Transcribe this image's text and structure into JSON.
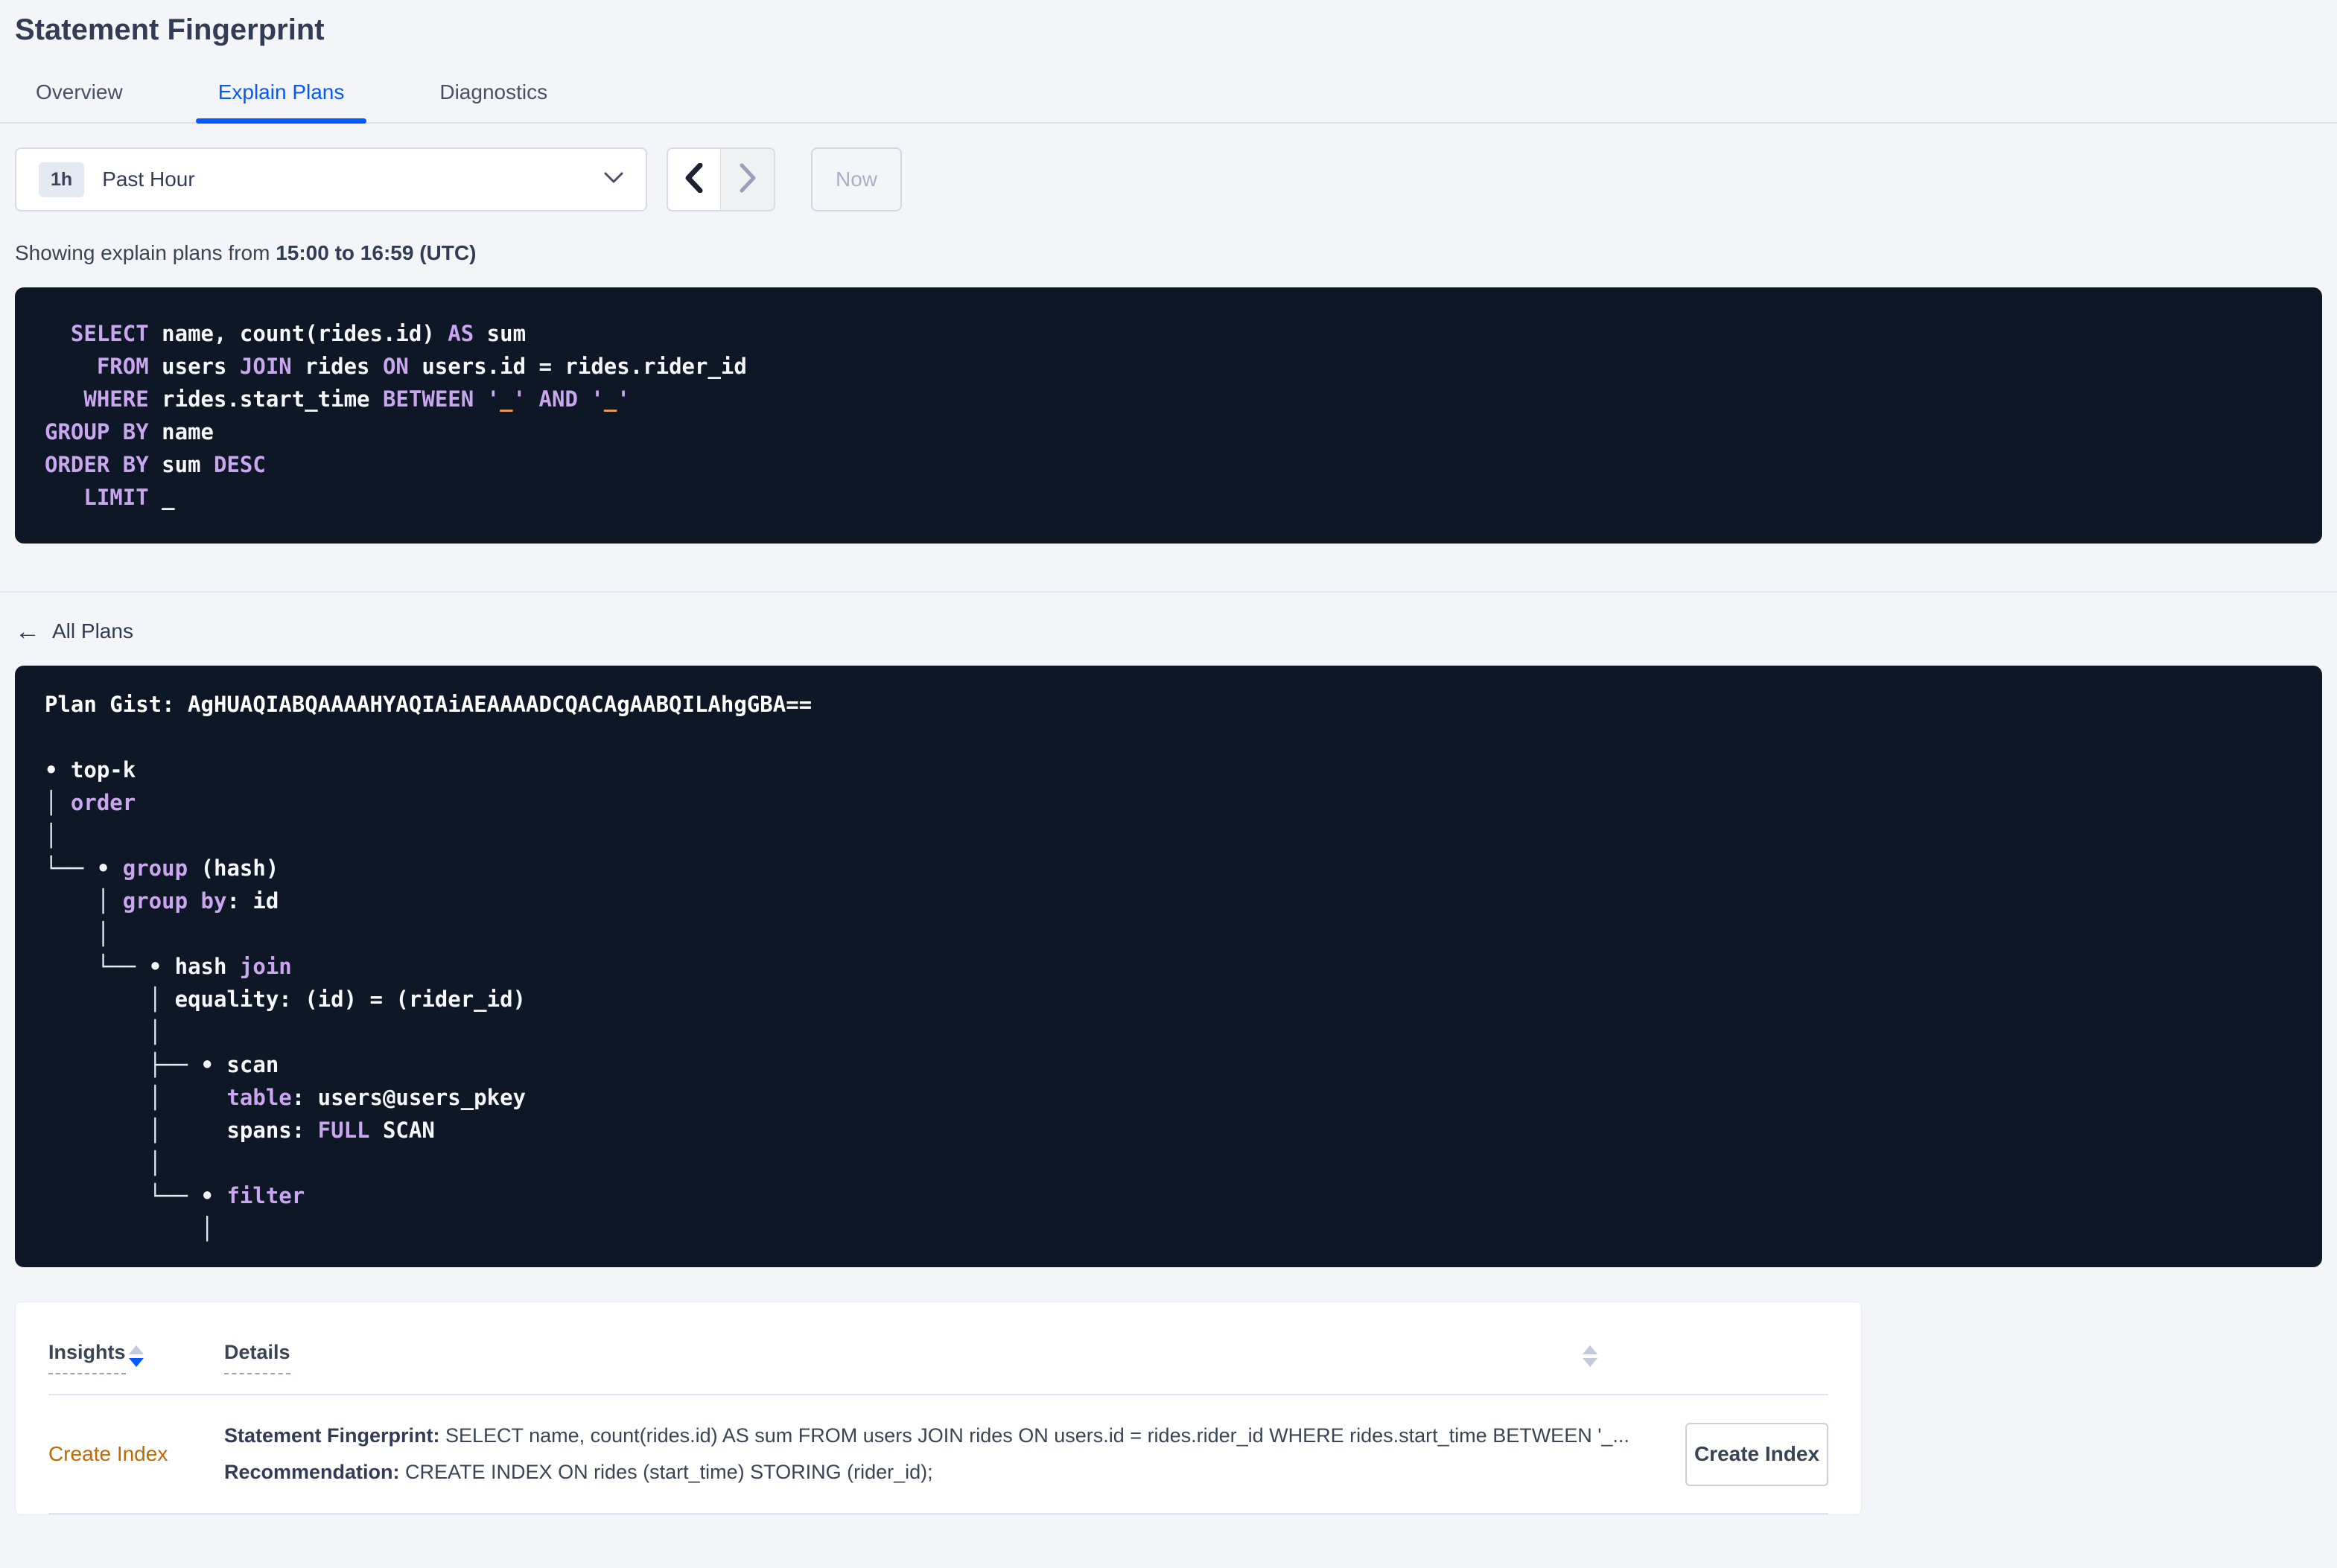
{
  "page": {
    "title": "Statement Fingerprint"
  },
  "tabs": [
    {
      "label": "Overview"
    },
    {
      "label": "Explain Plans"
    },
    {
      "label": "Diagnostics"
    }
  ],
  "toolbar": {
    "time_badge": "1h",
    "time_label": "Past Hour",
    "now_label": "Now"
  },
  "subtitle": {
    "prefix": "Showing explain plans from ",
    "bold": "15:00 to 16:59 (UTC)"
  },
  "colors": {
    "accent_blue": "#0458ff",
    "insight_orange": "#bf6a02",
    "code_background": "#0e1726",
    "code_keyword_purple": "#c9a6ee",
    "code_literal_orange": "#faa14c",
    "page_background": "#f4f5f9"
  },
  "sql_block": {
    "lines": [
      [
        [
          "p",
          "  "
        ],
        [
          "k",
          "SELECT"
        ],
        [
          "p",
          " name, count(rides.id) "
        ],
        [
          "k",
          "AS"
        ],
        [
          "p",
          " sum"
        ]
      ],
      [
        [
          "p",
          "    "
        ],
        [
          "k",
          "FROM"
        ],
        [
          "p",
          " users "
        ],
        [
          "k",
          "JOIN"
        ],
        [
          "p",
          " rides "
        ],
        [
          "k",
          "ON"
        ],
        [
          "p",
          " users.id = rides.rider_id"
        ]
      ],
      [
        [
          "p",
          "   "
        ],
        [
          "k",
          "WHERE"
        ],
        [
          "p",
          " rides.start_time "
        ],
        [
          "k",
          "BETWEEN"
        ],
        [
          "p",
          " "
        ],
        [
          "k",
          "'"
        ],
        [
          "o",
          "_"
        ],
        [
          "k",
          "'"
        ],
        [
          "p",
          " "
        ],
        [
          "k",
          "AND"
        ],
        [
          "p",
          " "
        ],
        [
          "k",
          "'"
        ],
        [
          "o",
          "_"
        ],
        [
          "k",
          "'"
        ]
      ],
      [
        [
          "k",
          "GROUP BY"
        ],
        [
          "p",
          " name"
        ]
      ],
      [
        [
          "k",
          "ORDER BY"
        ],
        [
          "p",
          " sum "
        ],
        [
          "k",
          "DESC"
        ]
      ],
      [
        [
          "p",
          "   "
        ],
        [
          "k",
          "LIMIT"
        ],
        [
          "p",
          " _"
        ]
      ]
    ]
  },
  "all_plans": {
    "label": "All Plans",
    "arrow": "←"
  },
  "gist_block": {
    "lines": [
      [
        [
          "g",
          "Plan Gist: AgHUAQIABQAAAAHYAQIAiAEAAAADCQACAgAABQILAhgGBA=="
        ]
      ],
      [],
      [
        [
          "p",
          "• top-k"
        ]
      ],
      [
        [
          "t",
          "│ "
        ],
        [
          "k",
          "order"
        ]
      ],
      [
        [
          "t",
          "│"
        ]
      ],
      [
        [
          "t",
          "└── "
        ],
        [
          "p",
          "• "
        ],
        [
          "k",
          "group"
        ],
        [
          "p",
          " (hash)"
        ]
      ],
      [
        [
          "t",
          "    │ "
        ],
        [
          "k",
          "group by"
        ],
        [
          "p",
          ": id"
        ]
      ],
      [
        [
          "t",
          "    │"
        ]
      ],
      [
        [
          "t",
          "    └── "
        ],
        [
          "p",
          "• hash "
        ],
        [
          "k",
          "join"
        ]
      ],
      [
        [
          "t",
          "        │ "
        ],
        [
          "p",
          "equality: (id) = (rider_id)"
        ]
      ],
      [
        [
          "t",
          "        │"
        ]
      ],
      [
        [
          "t",
          "        ├── "
        ],
        [
          "p",
          "• scan"
        ]
      ],
      [
        [
          "t",
          "        │     "
        ],
        [
          "k",
          "table"
        ],
        [
          "p",
          ": users@users_pkey"
        ]
      ],
      [
        [
          "t",
          "        │     "
        ],
        [
          "p",
          "spans: "
        ],
        [
          "k",
          "FULL"
        ],
        [
          "p",
          " SCAN"
        ]
      ],
      [
        [
          "t",
          "        │"
        ]
      ],
      [
        [
          "t",
          "        └── "
        ],
        [
          "p",
          "• "
        ],
        [
          "k",
          "filter"
        ]
      ],
      [
        [
          "t",
          "            │"
        ]
      ]
    ]
  },
  "insights_table": {
    "columns": {
      "insights": "Insights",
      "details": "Details"
    },
    "row": {
      "insight": "Create Index",
      "line1_label": "Statement Fingerprint:",
      "line1_text": " SELECT name, count(rides.id) AS sum FROM users JOIN rides ON users.id = rides.rider_id WHERE rides.start_time BETWEEN '_...",
      "line2_label": "Recommendation:",
      "line2_text": " CREATE INDEX ON rides (start_time) STORING (rider_id);",
      "action_label": "Create Index"
    }
  }
}
